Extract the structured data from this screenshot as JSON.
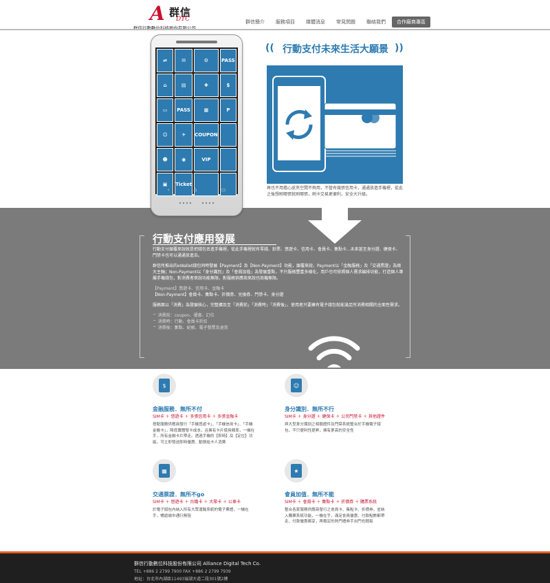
{
  "header": {
    "logo_mark": "A",
    "logo_cn": "群信",
    "logo_en": "DTC",
    "company": "群信行動數位科技股份有限公司",
    "nav": [
      "群信簡介",
      "服務項目",
      "媒體消息",
      "常見問題",
      "聯絡我們",
      "合作廠商專區"
    ]
  },
  "phone": {
    "tiles": [
      "⇌",
      "✉",
      "⚙",
      "PASS",
      "⌂",
      "▤",
      "✚",
      "$",
      "▭",
      "PASS",
      "▦",
      "P",
      "☺",
      "✈",
      "COUPON",
      "",
      "☻",
      "◉",
      "VIP",
      "",
      "▣",
      "Ticket",
      "",
      ""
    ],
    "nav": [
      "‹",
      "⌂",
      "▭"
    ]
  },
  "vision": {
    "title": "行動支付未來生活大願景",
    "text": "再也不用擔心皮夾空間不夠用，不管有幾張信用卡，通通放進手機裡，從此之後想刷哪張就刷哪張，刷卡交易更便利，安全大升級。"
  },
  "development": {
    "title": "行動支付應用發展",
    "p1": "行動支付顛覆來說就是把錢包丟進手機裡，從此手機裡就有零錢、鈔票、悠遊卡、信用卡、會員卡、集點卡...未來甚至身分證、健保卡、門禁卡也可以通通放進去。",
    "p2": "群信所推出的eWallet錢包同時發展【Payment】及【Non-Payment】功能，顛覆來說，Payment以「金融服務」及「交通票證」為兩大主軸；Non-Payment以「身分識別」及「會員加值」為發展重點，不只服務豐富多樣化，用戶也可依照個人需求編排功能，打造個人專屬手機錢包，對消費者來說功能無限，對服務供應商來說也商機無限。",
    "p3a": "【Payment】悠遊卡、信用卡、金融卡",
    "p3b": "【Non-Payment】會員卡、集點卡、折價券、兌換券、門禁卡、身分證",
    "p4": "服務面以「消費」為發展核心，完整擴及至「消費前」「消費時」「消費後」，使用者只要擁有電子錢包就能滿足所消費相關的全面性需求。",
    "features": [
      "消費前：coupon、優惠、訂位",
      "消費時：行動、會員卡折扣",
      "消費後：集點、紀帳、電子發票及退貨"
    ]
  },
  "cards": [
    {
      "title": "金融服務．無所不付",
      "sub": "SIM卡 ＋ 悠遊卡 ＋ 多張信用卡 ＋ 多張金融卡",
      "body": "搭配服務供應商發行「手機悠遊卡」、「手機信用卡」、「手機金融卡」，降低實體發卡成本，且擁有卡片使用頻率，一機在手，所有金融卡片帶走。透過手機的【即時】及【定位】功能，可立即發送即時優惠、動態給卡人消費"
    },
    {
      "title": "身分識別．無所不行",
      "sub": "SIM卡 ＋ 身分證 ＋ 健保卡 ＋ 公司門禁卡 ＋ 其他證件",
      "body": "與大型身分識別之相關證件及門禁系統整合於手機電子錢包，不只便利性提昇，擁有更高的安全性"
    },
    {
      "title": "交通票證．無所不go",
      "sub": "SIM卡 ＋ 悠遊卡 ＋ 台鐵卡 ＋ 大眾卡 ＋ 公車卡",
      "body": "於電子錢包內納入所有大眾運輸系統的電子票證，一機在手，暢遊城市通行無阻"
    },
    {
      "title": "會員加值．無所不能",
      "sub": "SIM卡 ＋ 會員卡 ＋ 集點卡 ＋ 折價券 ＋ 購票系統",
      "body": "整合各家服務供應商發行之會員卡、集點卡、折價券，並納入購票系統功能，一機在手，滿足會員優惠、付款點數都帶走，付款優惠都享，再鎖定的熱門禮券手出門也輕鬆"
    }
  ],
  "footer": {
    "company": "群信行動數位科技股份有限公司 Alliance Digital Tech Co.",
    "contact": "TEL +886 2 2799 7900 FAX +886 2 2799 7939",
    "address": "地址：台北市內湖區11493瑞湖大道二段301號2樓"
  },
  "colors": {
    "brand_blue": "#2d7bb0",
    "brand_red": "#c8102e",
    "band_gray": "#7b7b7b",
    "footer_accent": "#e85d22"
  }
}
